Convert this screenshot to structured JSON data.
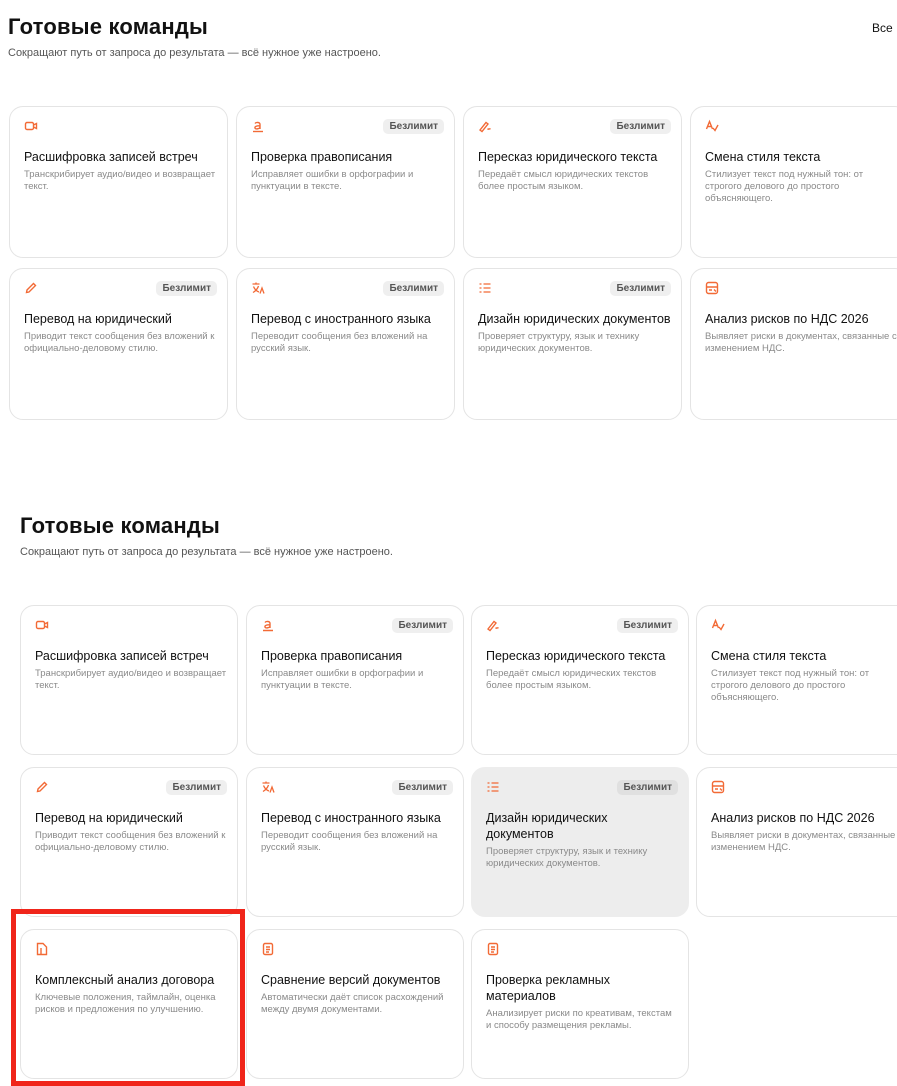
{
  "top": {
    "title": "Готовые команды",
    "subtitle": "Сокращают путь от запроса до результата — всё нужное уже настроено.",
    "all_label": "Все",
    "cards": [
      {
        "icon": "video-icon",
        "title": "Расшифровка записей встреч",
        "desc": "Транскрибирует аудио/видео и возвращает текст.",
        "badge": ""
      },
      {
        "icon": "spellcheck-icon",
        "title": "Проверка правописания",
        "desc": "Исправляет ошибки в орфографии и пунктуации в тексте.",
        "badge": "Безлимит"
      },
      {
        "icon": "pen-icon",
        "title": "Пересказ юридического текста",
        "desc": "Передаёт смысл юридических текстов более простым языком.",
        "badge": "Безлимит"
      },
      {
        "icon": "text-style-icon",
        "title": "Смена стиля текста",
        "desc": "Стилизует текст под нужный тон: от строгого делового до простого объясняющего.",
        "badge": ""
      },
      {
        "icon": "pencil-icon",
        "title": "Перевод на юридический",
        "desc": "Приводит текст сообщения без вложений к официально-деловому стилю.",
        "badge": "Безлимит"
      },
      {
        "icon": "translate-icon",
        "title": "Перевод с иностранного языка",
        "desc": "Переводит сообщения без вложений на русский язык.",
        "badge": "Безлимит"
      },
      {
        "icon": "checklist-icon",
        "title": "Дизайн юридических документов",
        "desc": "Проверяет структуру, язык и технику юридических документов.",
        "badge": "Безлимит"
      },
      {
        "icon": "tax-doc-icon",
        "title": "Анализ рисков по НДС 2026",
        "desc": "Выявляет риски в документах, связанные с изменением НДС.",
        "badge": ""
      }
    ]
  },
  "bottom": {
    "title": "Готовые команды",
    "subtitle": "Сокращают путь от запроса до результата — всё нужное уже настроено.",
    "cards": [
      {
        "icon": "video-icon",
        "title": "Расшифровка записей встреч",
        "desc": "Транскрибирует аудио/видео и возвращает текст.",
        "badge": ""
      },
      {
        "icon": "spellcheck-icon",
        "title": "Проверка правописания",
        "desc": "Исправляет ошибки в орфографии и пунктуации в тексте.",
        "badge": "Безлимит"
      },
      {
        "icon": "pen-icon",
        "title": "Пересказ юридического текста",
        "desc": "Передаёт смысл юридических текстов более простым языком.",
        "badge": "Безлимит"
      },
      {
        "icon": "text-style-icon",
        "title": "Смена стиля текста",
        "desc": "Стилизует текст под нужный тон: от строгого делового до простого объясняющего.",
        "badge": ""
      },
      {
        "icon": "pencil-icon",
        "title": "Перевод на юридический",
        "desc": "Приводит текст сообщения без вложений к официально-деловому стилю.",
        "badge": "Безлимит"
      },
      {
        "icon": "translate-icon",
        "title": "Перевод с иностранного языка",
        "desc": "Переводит сообщения без вложений на русский язык.",
        "badge": "Безлимит"
      },
      {
        "icon": "checklist-icon",
        "title": "Дизайн юридических документов",
        "desc": "Проверяет структуру, язык и технику юридических документов.",
        "badge": "Безлимит",
        "hovered": true
      },
      {
        "icon": "tax-doc-icon",
        "title": "Анализ рисков по НДС 2026",
        "desc": "Выявляет риски в документах, связанные с изменением НДС.",
        "badge": ""
      },
      {
        "icon": "contract-icon",
        "title": "Комплексный анализ договора",
        "desc": "Ключевые положения, таймлайн, оценка рисков и предложения по улучшению.",
        "badge": "",
        "highlighted": true
      },
      {
        "icon": "document-icon",
        "title": "Сравнение версий документов",
        "desc": "Автоматически даёт список расхождений между двумя документами.",
        "badge": ""
      },
      {
        "icon": "document-icon",
        "title": "Проверка рекламных материалов",
        "desc": "Анализирует риски по креативам, текстам и способу размещения рекламы.",
        "badge": ""
      }
    ]
  },
  "colors": {
    "accent": "#f26a36",
    "highlight": "#f0251a",
    "hover_bg": "#ededed"
  }
}
